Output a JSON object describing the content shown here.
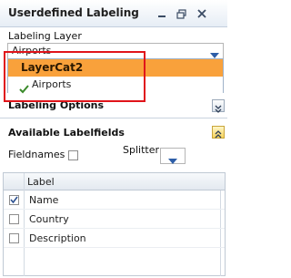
{
  "window": {
    "title": "Userdefined Labeling",
    "minimize_icon": "minimize-icon",
    "restore_icon": "restore-icon",
    "close_icon": "close-icon"
  },
  "labeling_layer": {
    "label": "Labeling Layer",
    "selected_value": "Airports",
    "options": [
      {
        "label": "LayerCat2",
        "highlighted": true,
        "checked": false
      },
      {
        "label": "Airports",
        "highlighted": false,
        "checked": true
      }
    ]
  },
  "labeling_options": {
    "label": "Labeling Options"
  },
  "available_labelfields": {
    "label": "Available Labelfields",
    "fieldnames_label": "Fieldnames",
    "splitter_label": "Splitter",
    "grid": {
      "column_header": "Label",
      "rows": [
        {
          "label": "Name",
          "checked": true
        },
        {
          "label": "Country",
          "checked": false
        },
        {
          "label": "Description",
          "checked": false
        }
      ]
    }
  },
  "colors": {
    "highlight_orange": "#f9a13b",
    "annotation_red": "#e0141a",
    "check_green": "#3a8a2a"
  }
}
